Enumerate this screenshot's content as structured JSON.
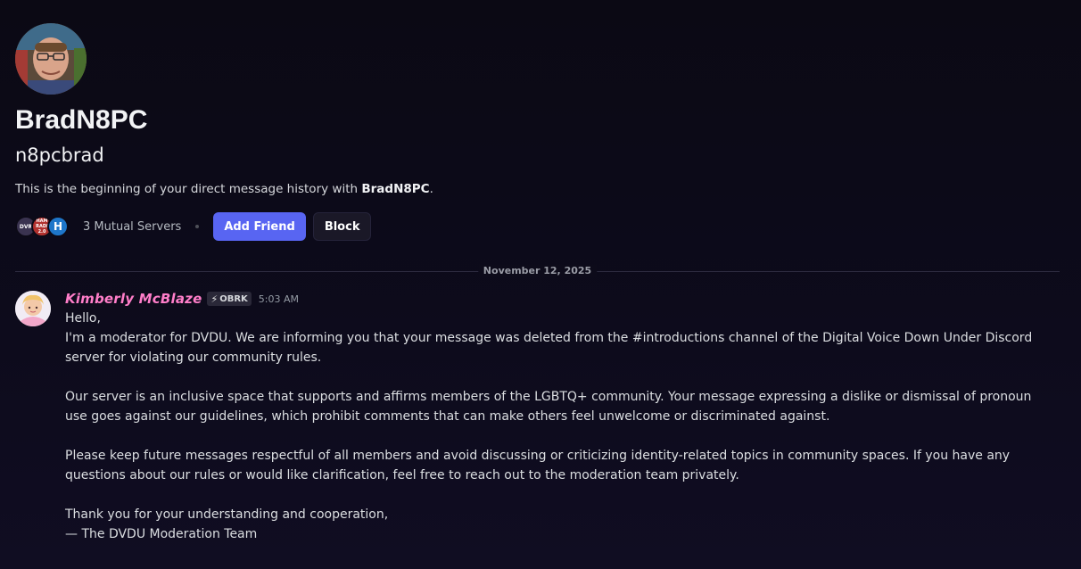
{
  "profile": {
    "display_name": "BradN8PC",
    "username": "n8pcbrad",
    "beginning_prefix": "This is the beginning of your direct message history with ",
    "beginning_name": "BradN8PC",
    "beginning_suffix": "."
  },
  "mutual": {
    "servers": [
      {
        "icon": "dvr-server-icon",
        "label": "DVR",
        "color": "#3a3350"
      },
      {
        "icon": "ham-radio-server-icon",
        "label_lines": [
          "HAM",
          "RADI",
          "2.0"
        ],
        "color": "#b2322f"
      },
      {
        "icon": "h-server-icon",
        "label": "H",
        "color": "#1e76c9"
      }
    ],
    "label": "3 Mutual Servers"
  },
  "buttons": {
    "add_friend": "Add Friend",
    "block": "Block"
  },
  "divider": {
    "date": "November 12, 2025"
  },
  "message": {
    "author": "Kimberly McBlaze",
    "tag": "OBRK",
    "timestamp": "5:03 AM",
    "paragraphs": [
      [
        "Hello,",
        "I'm a moderator for DVDU. We are informing you that your message was deleted from the #introductions channel of the Digital Voice Down Under Discord server for violating our community rules."
      ],
      [
        "Our server is an inclusive space that supports and affirms members of the LGBTQ+ community. Your message expressing a dislike or dismissal of pronoun use goes against our guidelines, which prohibit comments that can make others feel unwelcome or discriminated against."
      ],
      [
        "Please keep future messages respectful of all members and avoid discussing or criticizing identity-related topics in community spaces. If you have any questions about our rules or would like clarification, feel free to reach out to the moderation team privately."
      ],
      [
        "Thank you for your understanding and cooperation,",
        "— The DVDU Moderation Team"
      ]
    ]
  },
  "colors": {
    "accent": "#5865f2",
    "author": "#ff7ec9",
    "background": "#0d0b1a"
  }
}
